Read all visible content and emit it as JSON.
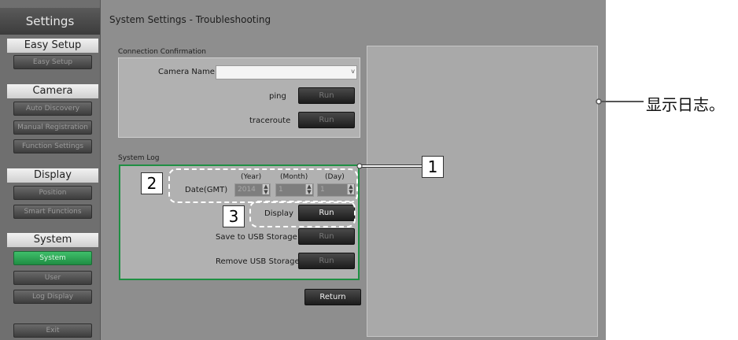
{
  "sidebar": {
    "title": "Settings",
    "sections": [
      {
        "heading": "Easy Setup",
        "items": [
          "Easy Setup"
        ]
      },
      {
        "heading": "Camera",
        "items": [
          "Auto Discovery",
          "Manual Registration",
          "Function Settings"
        ]
      },
      {
        "heading": "Display",
        "items": [
          "Position",
          "Smart Functions"
        ]
      },
      {
        "heading": "System",
        "items": [
          "System",
          "User",
          "Log Display"
        ]
      }
    ],
    "exit": "Exit"
  },
  "main": {
    "title": "System Settings - Troubleshooting",
    "connection": {
      "label": "Connection Confirmation",
      "camera_name_label": "Camera Name",
      "camera_name_value": "",
      "dropdown_arrow": "v",
      "ping_label": "ping",
      "traceroute_label": "traceroute",
      "run": "Run"
    },
    "system_log": {
      "label": "System Log",
      "year_label": "(Year)",
      "month_label": "(Month)",
      "day_label": "(Day)",
      "date_label": "Date(GMT)",
      "year_value": "2014",
      "month_value": "1",
      "day_value": "1",
      "display_label": "Display",
      "display_button": "Run",
      "save_usb_label": "Save to USB Storage",
      "save_usb_button": "Run",
      "remove_usb_label": "Remove USB Storage",
      "remove_usb_button": "Run"
    },
    "return_button": "Return"
  },
  "annotations": {
    "callout_1": "1",
    "callout_2": "2",
    "callout_3": "3",
    "log_note": "显示日志。"
  }
}
